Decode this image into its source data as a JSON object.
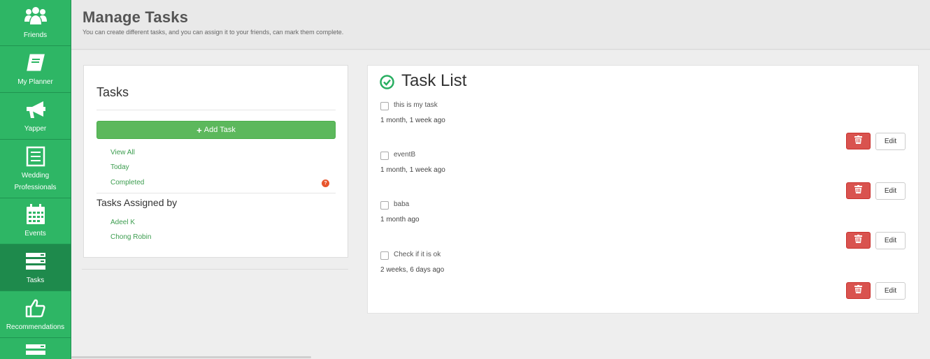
{
  "sidebar": {
    "items": [
      {
        "label": "Friends",
        "icon": "users-icon"
      },
      {
        "label": "My Planner",
        "icon": "book-icon"
      },
      {
        "label": "Yapper",
        "icon": "megaphone-icon"
      },
      {
        "label": "Wedding Professionals",
        "icon": "list-icon"
      },
      {
        "label": "Events",
        "icon": "calendar-icon"
      },
      {
        "label": "Tasks",
        "icon": "tasks-icon",
        "active": true
      },
      {
        "label": "Recommendations",
        "icon": "thumbs-up-icon"
      }
    ]
  },
  "header": {
    "title": "Manage Tasks",
    "subtitle": "You can create different tasks, and you can assign it to your friends, can mark them complete."
  },
  "tasks_panel": {
    "title": "Tasks",
    "add_button": "Add Task",
    "filters": [
      "View All",
      "Today",
      "Completed"
    ],
    "completed_badge": "?",
    "assigned_title": "Tasks Assigned by",
    "assigned_by": [
      "Adeel K",
      "Chong Robin"
    ]
  },
  "task_list": {
    "title": "Task List",
    "tasks": [
      {
        "name": "this is my task",
        "time": "1 month, 1 week ago"
      },
      {
        "name": "eventB",
        "time": "1 month, 1 week ago"
      },
      {
        "name": "baba",
        "time": "1 month ago"
      },
      {
        "name": "Check if it is ok",
        "time": "2 weeks, 6 days ago"
      }
    ],
    "delete_icon": "trash-icon",
    "edit_label": "Edit"
  },
  "colors": {
    "sidebar": "#27ae60",
    "sidebar_active": "#1e8a4c",
    "add_button": "#5cb85c",
    "delete_button": "#d9534f",
    "link": "#3c9d4f",
    "badge": "#e8552c"
  }
}
